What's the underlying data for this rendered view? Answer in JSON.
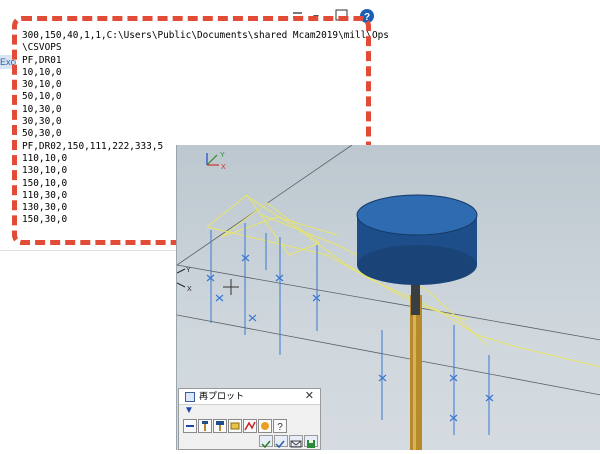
{
  "background_app": {
    "partial_tab": "Exce"
  },
  "csv_file": {
    "lines": [
      "300,150,40,1,1,C:\\Users\\Public\\Documents\\shared Mcam2019\\mill\\Ops",
      "\\CSVOPS",
      "PF,DR01",
      "10,10,0",
      "30,10,0",
      "50,10,0",
      "10,30,0",
      "30,30,0",
      "50,30,0",
      "PF,DR02,150,111,222,333,5",
      "110,10,0",
      "130,10,0",
      "150,10,0",
      "110,30,0",
      "130,30,0",
      "150,30,0"
    ]
  },
  "viewport": {
    "axis_labels": {
      "y": "Y",
      "x": "X"
    }
  },
  "palette": {
    "title": "再プロット",
    "close_symbol": "✕",
    "expand_symbol": "▼",
    "help_symbol": "?"
  },
  "colors": {
    "highlight_dash": "#e24b35",
    "toolpath": "#e8e46a",
    "drill_line": "#3a78d0",
    "tool_holder": "#1e4e8a",
    "tool_shank": "#b58a2a"
  }
}
